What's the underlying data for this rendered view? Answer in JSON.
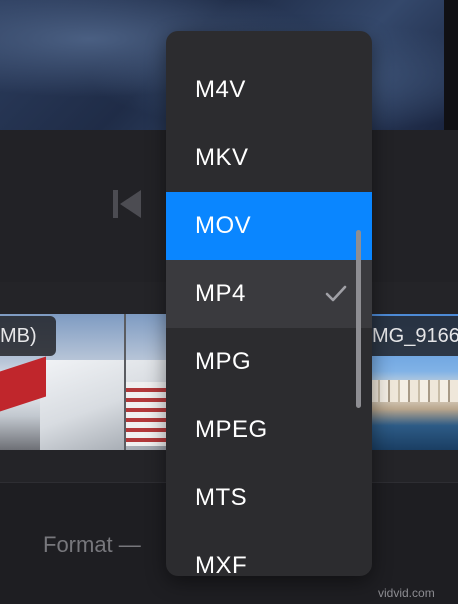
{
  "dropdown": {
    "items": [
      {
        "label": "M4V"
      },
      {
        "label": "MKV"
      },
      {
        "label": "MOV"
      },
      {
        "label": "MP4"
      },
      {
        "label": "MPG"
      },
      {
        "label": "MPEG"
      },
      {
        "label": "MTS"
      },
      {
        "label": "MXF"
      }
    ],
    "highlighted_label": "MOV",
    "checked_label": "MP4"
  },
  "timeline": {
    "clip_left_label": "MB)",
    "clip_right_label": "MG_9166"
  },
  "format": {
    "label": "Format —"
  },
  "watermark": "vidvid.com",
  "colors": {
    "accent": "#0a86ff",
    "menu_bg": "#2c2c2f",
    "menu_current_bg": "#3a3a3e",
    "app_bg": "#1c1c1f"
  },
  "icons": [
    "skip-back-icon",
    "checkmark-icon"
  ]
}
